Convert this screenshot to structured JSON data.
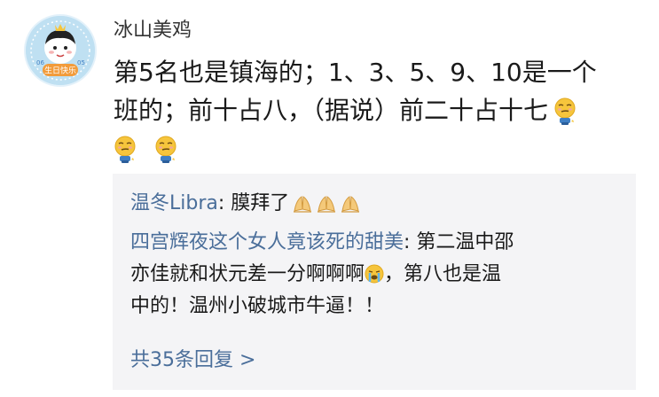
{
  "post": {
    "author": "冰山美鸡",
    "avatar_badge": "生日快乐",
    "avatar_left_text": "06",
    "avatar_right_text": "05",
    "text_lines": [
      "第5名也是镇海的；1、3、5、9、10是一个",
      "班的；前十占八，（据说）前二十占十七"
    ],
    "trailing_emoji": "smirk-emoji"
  },
  "comments": [
    {
      "name": "温冬Libra",
      "sep": ": ",
      "text": "膜拜了",
      "emoji": "pray-emoji"
    },
    {
      "name": "四宫辉夜这个女人竟该死的甜美",
      "sep": ": ",
      "line1_text": "第二温中邵",
      "line2_text_a": "亦佳就和状元差一分啊啊啊",
      "line2_text_b": "，第八也是温",
      "line3_text": "中的！温州小破城市牛逼！！",
      "emoji": "crying-emoji"
    }
  ],
  "more_replies": "共35条回复 >",
  "colors": {
    "link_blue": "#4a6e9a",
    "comment_bg": "#f4f4f6",
    "text": "#1a1a1a"
  }
}
